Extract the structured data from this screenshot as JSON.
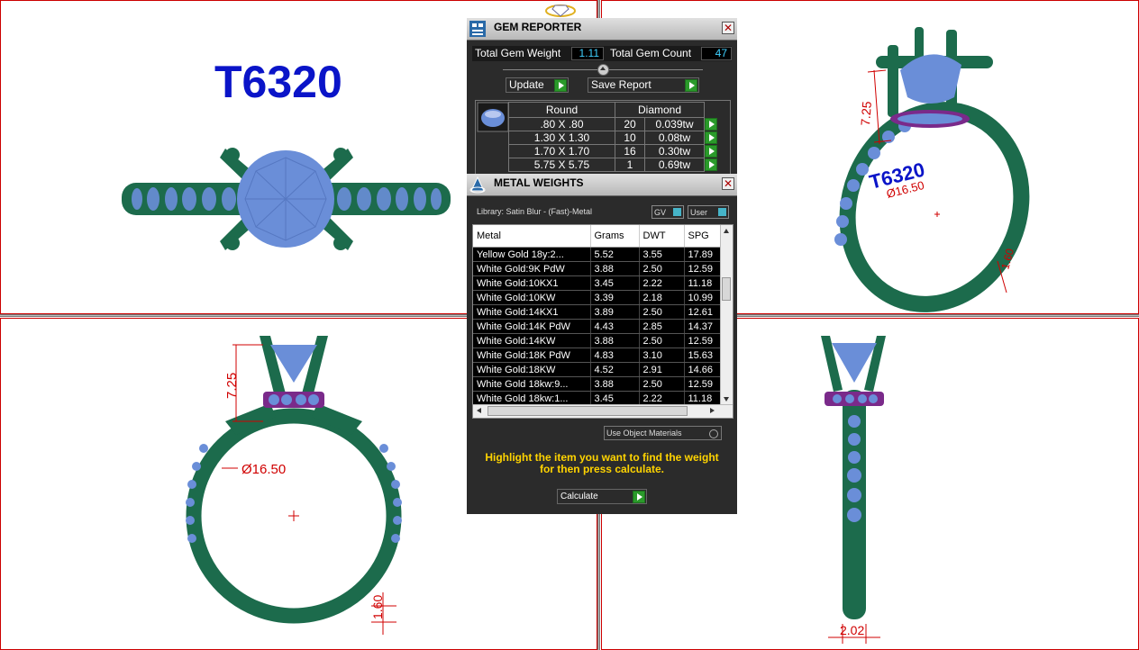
{
  "views": {
    "top_left": {
      "model_label": "T6320"
    },
    "top_right": {
      "model_label": "T6320",
      "dim_height": "7.25",
      "dim_diameter": "Ø16.50",
      "dim_shank": "1.60"
    },
    "bottom_left": {
      "dim_height": "7.25",
      "dim_diameter": "Ø16.50",
      "dim_shank": "1.60"
    },
    "bottom_right": {
      "dim_width": "2.02"
    }
  },
  "gem_reporter": {
    "title": "GEM REPORTER",
    "total_weight_label": "Total Gem Weight",
    "total_weight_value": "1.11",
    "total_count_label": "Total Gem Count",
    "total_count_value": "47",
    "update_label": "Update",
    "save_report_label": "Save Report",
    "table": {
      "shape_header": "Round",
      "type_header": "Diamond",
      "rows": [
        {
          "size": ".80 X .80",
          "count": "20",
          "weight": "0.039tw"
        },
        {
          "size": "1.30 X 1.30",
          "count": "10",
          "weight": "0.08tw"
        },
        {
          "size": "1.70 X 1.70",
          "count": "16",
          "weight": "0.30tw"
        },
        {
          "size": "5.75 X 5.75",
          "count": "1",
          "weight": "0.69tw"
        }
      ]
    }
  },
  "metal_weights": {
    "title": "METAL WEIGHTS",
    "library_label": "Library: Satin Blur - (Fast)-Metal",
    "gv_label": "GV",
    "user_label": "User",
    "columns": [
      "Metal",
      "Grams",
      "DWT",
      "SPG"
    ],
    "rows": [
      [
        "Yellow Gold  18y:2...",
        "5.52",
        "3.55",
        "17.89"
      ],
      [
        "White Gold:9K PdW",
        "3.88",
        "2.50",
        "12.59"
      ],
      [
        "White Gold:10KX1",
        "3.45",
        "2.22",
        "11.18"
      ],
      [
        "White Gold:10KW",
        "3.39",
        "2.18",
        "10.99"
      ],
      [
        "White Gold:14KX1",
        "3.89",
        "2.50",
        "12.61"
      ],
      [
        "White Gold:14K PdW",
        "4.43",
        "2.85",
        "14.37"
      ],
      [
        "White Gold:14KW",
        "3.88",
        "2.50",
        "12.59"
      ],
      [
        "White Gold:18K PdW",
        "4.83",
        "3.10",
        "15.63"
      ],
      [
        "White Gold:18KW",
        "4.52",
        "2.91",
        "14.66"
      ],
      [
        "White Gold 18kw:9...",
        "3.88",
        "2.50",
        "12.59"
      ],
      [
        "White Gold 18kw:1...",
        "3.45",
        "2.22",
        "11.18"
      ]
    ],
    "use_object_materials_label": "Use Object Materials",
    "hint_text_line1": "Highlight the item you want to find the weight",
    "hint_text_line2": "for then press calculate.",
    "calculate_label": "Calculate"
  },
  "colors": {
    "metal": "#1c6b4c",
    "gem": "#6a8ed8",
    "accent_gem": "#7a2a8a",
    "dimension": "#d00000",
    "label": "#0a14c8"
  }
}
